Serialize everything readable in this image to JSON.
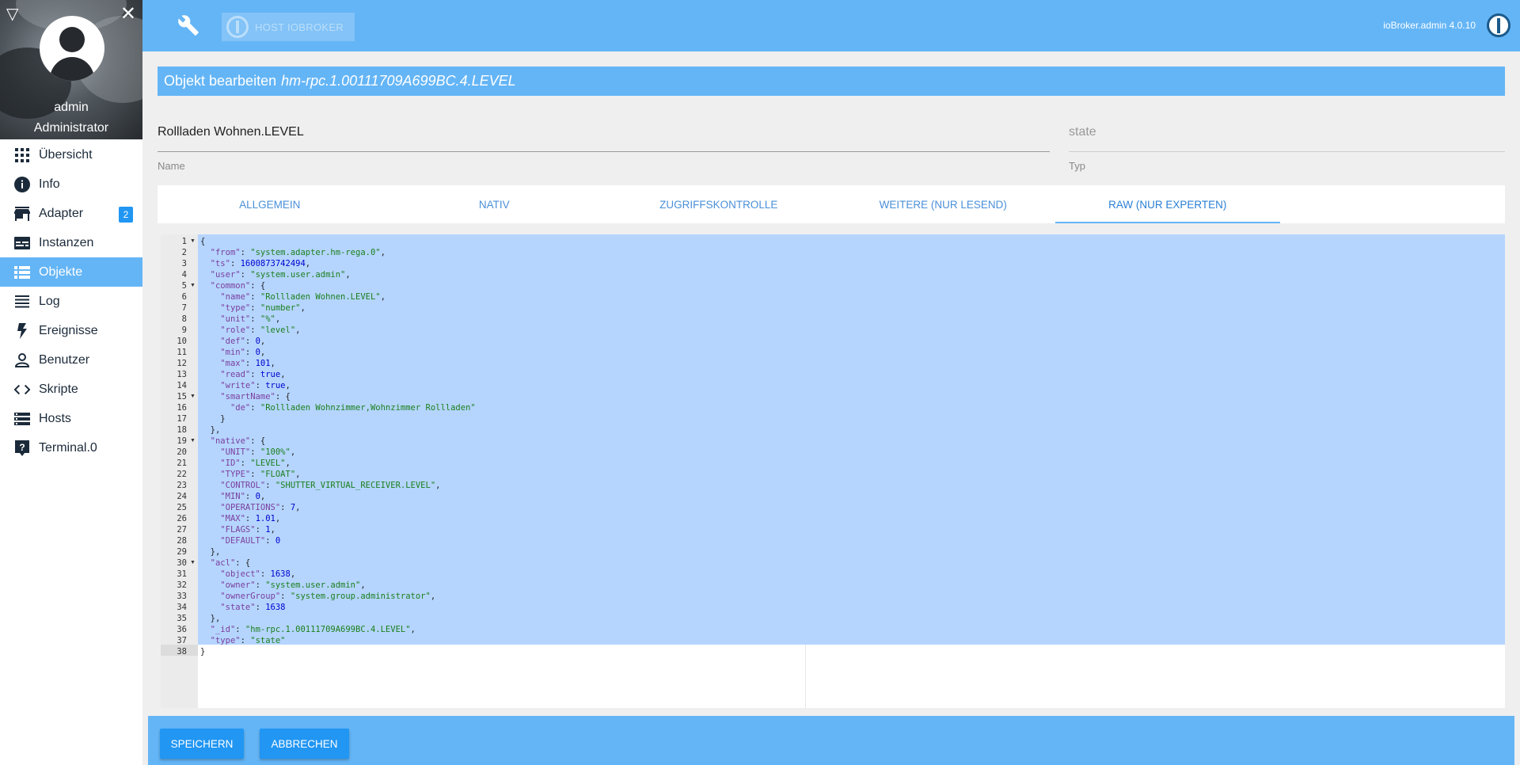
{
  "sidebar": {
    "user_name": "admin",
    "user_role": "Administrator",
    "items": [
      {
        "label": "Übersicht",
        "icon": "apps-grid-icon"
      },
      {
        "label": "Info",
        "icon": "info-icon"
      },
      {
        "label": "Adapter",
        "icon": "store-icon",
        "badge": "2"
      },
      {
        "label": "Instanzen",
        "icon": "instances-icon"
      },
      {
        "label": "Objekte",
        "icon": "list-icon",
        "active": true
      },
      {
        "label": "Log",
        "icon": "log-icon"
      },
      {
        "label": "Ereignisse",
        "icon": "flash-icon"
      },
      {
        "label": "Benutzer",
        "icon": "person-icon"
      },
      {
        "label": "Skripte",
        "icon": "code-icon"
      },
      {
        "label": "Hosts",
        "icon": "hosts-icon"
      },
      {
        "label": "Terminal.0",
        "icon": "help-box-icon"
      }
    ]
  },
  "topbar": {
    "host_label": "HOST IOBROKER",
    "version": "ioBroker.admin 4.0.10"
  },
  "dialog": {
    "title_prefix": "Objekt bearbeiten",
    "object_id": "hm-rpc.1.00111709A699BC.4.LEVEL",
    "name_value": "Rollladen Wohnen.LEVEL",
    "name_hint": "Name",
    "type_value": "state",
    "type_hint": "Typ",
    "tabs": [
      "ALLGEMEIN",
      "NATIV",
      "ZUGRIFFSKONTROLLE",
      "WEITERE (NUR LESEND)",
      "RAW (NUR EXPERTEN)"
    ],
    "active_tab": 4
  },
  "editor": {
    "lines": [
      {
        "n": "1",
        "fold": true,
        "t": [
          [
            "p",
            "{"
          ]
        ]
      },
      {
        "n": "2",
        "t": [
          [
            "p",
            "  "
          ],
          [
            "k",
            "\"from\""
          ],
          [
            "p",
            ": "
          ],
          [
            "s",
            "\"system.adapter.hm-rega.0\""
          ],
          [
            "p",
            ","
          ]
        ]
      },
      {
        "n": "3",
        "t": [
          [
            "p",
            "  "
          ],
          [
            "k",
            "\"ts\""
          ],
          [
            "p",
            ": "
          ],
          [
            "n",
            "1600873742494"
          ],
          [
            "p",
            ","
          ]
        ]
      },
      {
        "n": "4",
        "t": [
          [
            "p",
            "  "
          ],
          [
            "k",
            "\"user\""
          ],
          [
            "p",
            ": "
          ],
          [
            "s",
            "\"system.user.admin\""
          ],
          [
            "p",
            ","
          ]
        ]
      },
      {
        "n": "5",
        "fold": true,
        "t": [
          [
            "p",
            "  "
          ],
          [
            "k",
            "\"common\""
          ],
          [
            "p",
            ": {"
          ]
        ]
      },
      {
        "n": "6",
        "t": [
          [
            "p",
            "    "
          ],
          [
            "k",
            "\"name\""
          ],
          [
            "p",
            ": "
          ],
          [
            "s",
            "\"Rollladen Wohnen.LEVEL\""
          ],
          [
            "p",
            ","
          ]
        ]
      },
      {
        "n": "7",
        "t": [
          [
            "p",
            "    "
          ],
          [
            "k",
            "\"type\""
          ],
          [
            "p",
            ": "
          ],
          [
            "s",
            "\"number\""
          ],
          [
            "p",
            ","
          ]
        ]
      },
      {
        "n": "8",
        "t": [
          [
            "p",
            "    "
          ],
          [
            "k",
            "\"unit\""
          ],
          [
            "p",
            ": "
          ],
          [
            "s",
            "\"%\""
          ],
          [
            "p",
            ","
          ]
        ]
      },
      {
        "n": "9",
        "t": [
          [
            "p",
            "    "
          ],
          [
            "k",
            "\"role\""
          ],
          [
            "p",
            ": "
          ],
          [
            "s",
            "\"level\""
          ],
          [
            "p",
            ","
          ]
        ]
      },
      {
        "n": "10",
        "t": [
          [
            "p",
            "    "
          ],
          [
            "k",
            "\"def\""
          ],
          [
            "p",
            ": "
          ],
          [
            "n",
            "0"
          ],
          [
            "p",
            ","
          ]
        ]
      },
      {
        "n": "11",
        "t": [
          [
            "p",
            "    "
          ],
          [
            "k",
            "\"min\""
          ],
          [
            "p",
            ": "
          ],
          [
            "n",
            "0"
          ],
          [
            "p",
            ","
          ]
        ]
      },
      {
        "n": "12",
        "t": [
          [
            "p",
            "    "
          ],
          [
            "k",
            "\"max\""
          ],
          [
            "p",
            ": "
          ],
          [
            "n",
            "101"
          ],
          [
            "p",
            ","
          ]
        ]
      },
      {
        "n": "13",
        "t": [
          [
            "p",
            "    "
          ],
          [
            "k",
            "\"read\""
          ],
          [
            "p",
            ": "
          ],
          [
            "b",
            "true"
          ],
          [
            "p",
            ","
          ]
        ]
      },
      {
        "n": "14",
        "t": [
          [
            "p",
            "    "
          ],
          [
            "k",
            "\"write\""
          ],
          [
            "p",
            ": "
          ],
          [
            "b",
            "true"
          ],
          [
            "p",
            ","
          ]
        ]
      },
      {
        "n": "15",
        "fold": true,
        "t": [
          [
            "p",
            "    "
          ],
          [
            "k",
            "\"smartName\""
          ],
          [
            "p",
            ": {"
          ]
        ]
      },
      {
        "n": "16",
        "t": [
          [
            "p",
            "      "
          ],
          [
            "k",
            "\"de\""
          ],
          [
            "p",
            ": "
          ],
          [
            "s",
            "\"Rollladen Wohnzimmer,Wohnzimmer Rollladen\""
          ]
        ]
      },
      {
        "n": "17",
        "t": [
          [
            "p",
            "    }"
          ]
        ]
      },
      {
        "n": "18",
        "t": [
          [
            "p",
            "  },"
          ]
        ]
      },
      {
        "n": "19",
        "fold": true,
        "t": [
          [
            "p",
            "  "
          ],
          [
            "k",
            "\"native\""
          ],
          [
            "p",
            ": {"
          ]
        ]
      },
      {
        "n": "20",
        "t": [
          [
            "p",
            "    "
          ],
          [
            "k",
            "\"UNIT\""
          ],
          [
            "p",
            ": "
          ],
          [
            "s",
            "\"100%\""
          ],
          [
            "p",
            ","
          ]
        ]
      },
      {
        "n": "21",
        "t": [
          [
            "p",
            "    "
          ],
          [
            "k",
            "\"ID\""
          ],
          [
            "p",
            ": "
          ],
          [
            "s",
            "\"LEVEL\""
          ],
          [
            "p",
            ","
          ]
        ]
      },
      {
        "n": "22",
        "t": [
          [
            "p",
            "    "
          ],
          [
            "k",
            "\"TYPE\""
          ],
          [
            "p",
            ": "
          ],
          [
            "s",
            "\"FLOAT\""
          ],
          [
            "p",
            ","
          ]
        ]
      },
      {
        "n": "23",
        "t": [
          [
            "p",
            "    "
          ],
          [
            "k",
            "\"CONTROL\""
          ],
          [
            "p",
            ": "
          ],
          [
            "s",
            "\"SHUTTER_VIRTUAL_RECEIVER.LEVEL\""
          ],
          [
            "p",
            ","
          ]
        ]
      },
      {
        "n": "24",
        "t": [
          [
            "p",
            "    "
          ],
          [
            "k",
            "\"MIN\""
          ],
          [
            "p",
            ": "
          ],
          [
            "n",
            "0"
          ],
          [
            "p",
            ","
          ]
        ]
      },
      {
        "n": "25",
        "t": [
          [
            "p",
            "    "
          ],
          [
            "k",
            "\"OPERATIONS\""
          ],
          [
            "p",
            ": "
          ],
          [
            "n",
            "7"
          ],
          [
            "p",
            ","
          ]
        ]
      },
      {
        "n": "26",
        "t": [
          [
            "p",
            "    "
          ],
          [
            "k",
            "\"MAX\""
          ],
          [
            "p",
            ": "
          ],
          [
            "n",
            "1.01"
          ],
          [
            "p",
            ","
          ]
        ]
      },
      {
        "n": "27",
        "t": [
          [
            "p",
            "    "
          ],
          [
            "k",
            "\"FLAGS\""
          ],
          [
            "p",
            ": "
          ],
          [
            "n",
            "1"
          ],
          [
            "p",
            ","
          ]
        ]
      },
      {
        "n": "28",
        "t": [
          [
            "p",
            "    "
          ],
          [
            "k",
            "\"DEFAULT\""
          ],
          [
            "p",
            ": "
          ],
          [
            "n",
            "0"
          ]
        ]
      },
      {
        "n": "29",
        "t": [
          [
            "p",
            "  },"
          ]
        ]
      },
      {
        "n": "30",
        "fold": true,
        "t": [
          [
            "p",
            "  "
          ],
          [
            "k",
            "\"acl\""
          ],
          [
            "p",
            ": {"
          ]
        ]
      },
      {
        "n": "31",
        "t": [
          [
            "p",
            "    "
          ],
          [
            "k",
            "\"object\""
          ],
          [
            "p",
            ": "
          ],
          [
            "n",
            "1638"
          ],
          [
            "p",
            ","
          ]
        ]
      },
      {
        "n": "32",
        "t": [
          [
            "p",
            "    "
          ],
          [
            "k",
            "\"owner\""
          ],
          [
            "p",
            ": "
          ],
          [
            "s",
            "\"system.user.admin\""
          ],
          [
            "p",
            ","
          ]
        ]
      },
      {
        "n": "33",
        "t": [
          [
            "p",
            "    "
          ],
          [
            "k",
            "\"ownerGroup\""
          ],
          [
            "p",
            ": "
          ],
          [
            "s",
            "\"system.group.administrator\""
          ],
          [
            "p",
            ","
          ]
        ]
      },
      {
        "n": "34",
        "t": [
          [
            "p",
            "    "
          ],
          [
            "k",
            "\"state\""
          ],
          [
            "p",
            ": "
          ],
          [
            "n",
            "1638"
          ]
        ]
      },
      {
        "n": "35",
        "t": [
          [
            "p",
            "  },"
          ]
        ]
      },
      {
        "n": "36",
        "t": [
          [
            "p",
            "  "
          ],
          [
            "k",
            "\"_id\""
          ],
          [
            "p",
            ": "
          ],
          [
            "s",
            "\"hm-rpc.1.00111709A699BC.4.LEVEL\""
          ],
          [
            "p",
            ","
          ]
        ]
      },
      {
        "n": "37",
        "t": [
          [
            "p",
            "  "
          ],
          [
            "k",
            "\"type\""
          ],
          [
            "p",
            ": "
          ],
          [
            "s",
            "\"state\""
          ]
        ]
      },
      {
        "n": "38",
        "t": [
          [
            "p",
            "}"
          ]
        ]
      }
    ]
  },
  "footer": {
    "save_label": "SPEICHERN",
    "cancel_label": "ABBRECHEN"
  },
  "colors": {
    "primary": "#64b5f6",
    "button": "#2196f3",
    "selection": "#b5d5ff"
  }
}
